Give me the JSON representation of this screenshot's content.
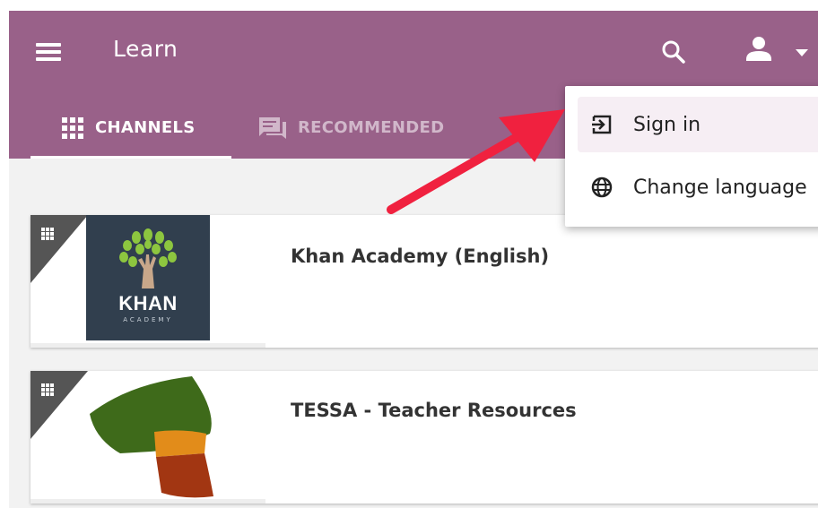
{
  "header": {
    "title": "Learn"
  },
  "tabs": [
    {
      "label": "CHANNELS",
      "icon": "grid-icon",
      "active": true
    },
    {
      "label": "RECOMMENDED",
      "icon": "recommended-icon",
      "active": false
    }
  ],
  "channels": [
    {
      "title": "Khan Academy (English)",
      "logo_text": "KHAN",
      "logo_subtext": "ACADEMY"
    },
    {
      "title": "TESSA - Teacher Resources"
    }
  ],
  "user_menu": {
    "items": [
      {
        "label": "Sign in",
        "icon": "sign-in-icon"
      },
      {
        "label": "Change language",
        "icon": "globe-icon"
      }
    ]
  },
  "colors": {
    "appbar": "#996189",
    "annotation_arrow": "#f0213f",
    "menu_highlight": "#f6eef4"
  }
}
